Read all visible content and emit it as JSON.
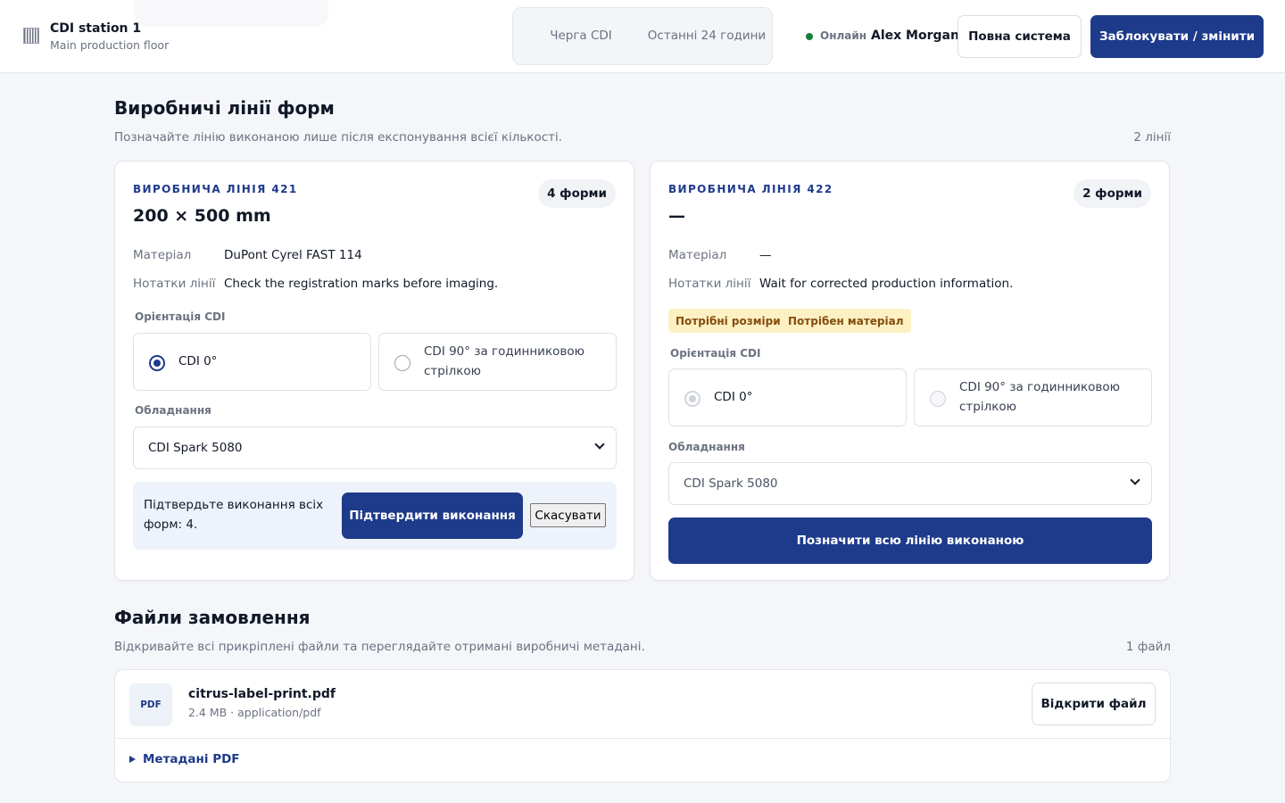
{
  "header": {
    "station_name": "CDI station 1",
    "station_subtitle": "Main production floor",
    "tabs": [
      {
        "label": "Черга CDI"
      },
      {
        "label": "Останні 24 години"
      }
    ],
    "status": {
      "label": "Онлайн",
      "color": "#15803d"
    },
    "user_name": "Alex Morgan",
    "full_system_label": "Повна система",
    "lock_label": "Заблокувати / змінити"
  },
  "lines_section": {
    "title": "Виробничі лінії форм",
    "description": "Позначайте лінію виконаною лише після експонування всієї кількості.",
    "count_label": "2 лінії"
  },
  "lines": [
    {
      "kicker": "ВИРОБНИЧА ЛІНІЯ 421",
      "size": "200 × 500 mm",
      "form_count": "4 форми",
      "material_label": "Матеріал",
      "material": "DuPont Cyrel FAST 114",
      "notes_label": "Нотатки лінії",
      "notes": "Check the registration marks before imaging.",
      "orientation_label": "Орієнтація CDI",
      "orientation_options": [
        "CDI 0°",
        "CDI 90° за годинниковою стрілкою"
      ],
      "orientation_selected": "CDI 0°",
      "equipment_label": "Обладнання",
      "equipment_value": "CDI Spark 5080",
      "confirm_text": "Підтвердьте виконання всіх форм: 4.",
      "confirm_button": "Підтвердити виконання",
      "cancel_button": "Скасувати"
    },
    {
      "kicker": "ВИРОБНИЧА ЛІНІЯ 422",
      "size": "—",
      "form_count": "2 форми",
      "material_label": "Матеріал",
      "material": "—",
      "notes_label": "Нотатки лінії",
      "notes": "Wait for corrected production information.",
      "badges": [
        "Потрібні розміри",
        "Потрібен матеріал"
      ],
      "orientation_label": "Орієнтація CDI",
      "orientation_options": [
        "CDI 0°",
        "CDI 90° за годинниковою стрілкою"
      ],
      "orientation_selected": "CDI 0°",
      "equipment_label": "Обладнання",
      "equipment_value": "CDI Spark 5080",
      "mark_done_button": "Позначити всю лінію виконаною"
    }
  ],
  "files_section": {
    "title": "Файли замовлення",
    "description": "Відкривайте всі прикріплені файли та переглядайте отримані виробничі метадані.",
    "count_label": "1 файл"
  },
  "files": [
    {
      "type_badge": "PDF",
      "name": "citrus-label-print.pdf",
      "meta": "2.4 MB · application/pdf",
      "open_button": "Відкрити файл",
      "metadata_toggle": "Метадані PDF"
    }
  ],
  "colors": {
    "accent": "#1e3a8a",
    "warning_bg": "#fdf1c3",
    "warning_text": "#854d0e",
    "page_bg": "#f4f6f9"
  }
}
